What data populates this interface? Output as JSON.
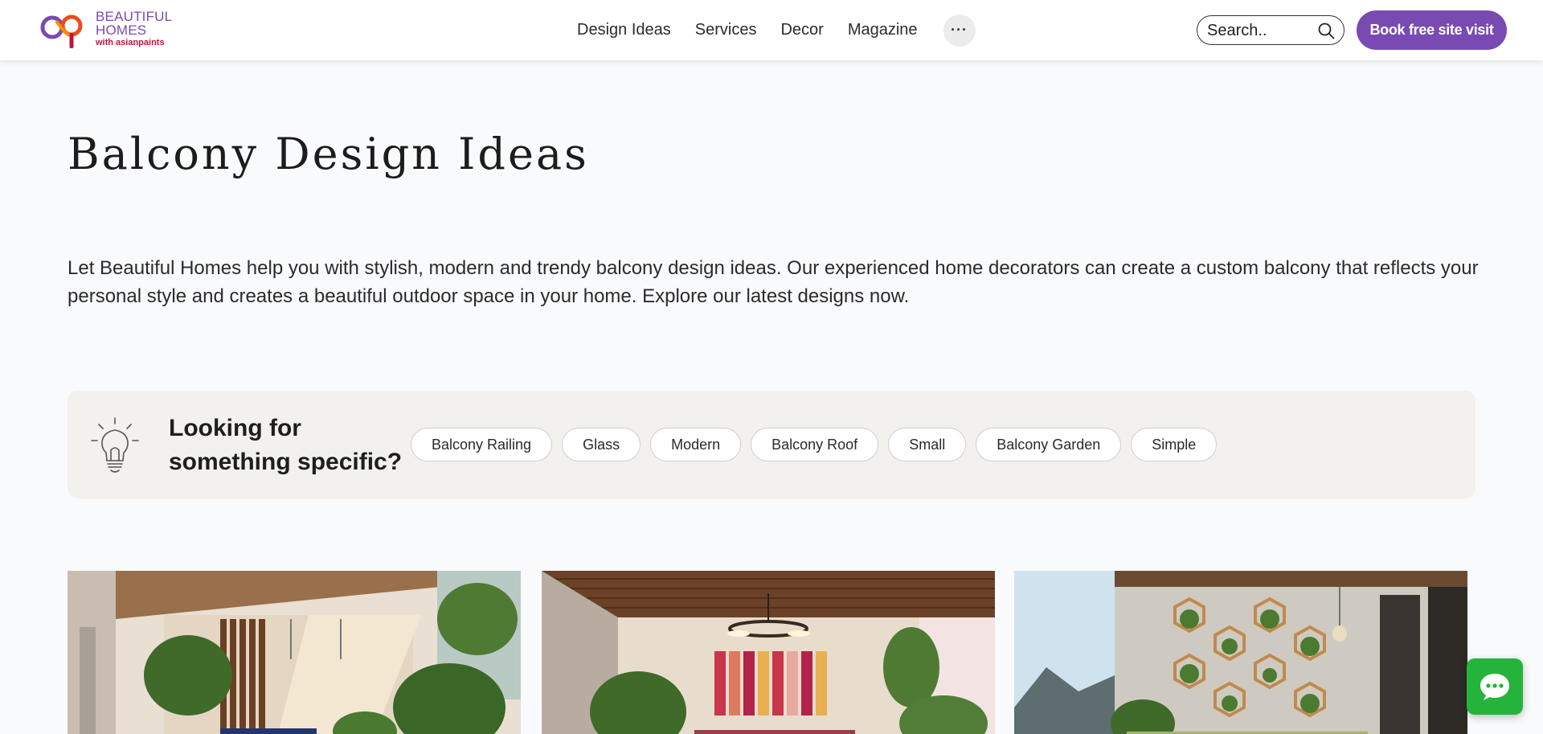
{
  "header": {
    "logo": {
      "line1": "BEAUTIFUL",
      "line2": "HOMES",
      "line3": "with asianpaints",
      "icon": "beautiful-homes-logo-icon"
    },
    "nav": {
      "items": [
        {
          "label": "Design Ideas"
        },
        {
          "label": "Services"
        },
        {
          "label": "Decor"
        },
        {
          "label": "Magazine"
        }
      ],
      "more_label": "···",
      "more_icon": "more-horizontal-icon"
    },
    "search": {
      "placeholder": "Search..",
      "value": "",
      "icon": "search-icon"
    },
    "cta_label": "Book free site visit"
  },
  "main": {
    "title": "Balcony Design Ideas",
    "intro": "Let Beautiful Homes help you with stylish, modern and trendy balcony design ideas. Our experienced home decorators can create a custom balcony that reflects your personal style and creates a beautiful outdoor space in your home. Explore our latest designs now.",
    "filter": {
      "icon": "lightbulb-icon",
      "heading": "Looking for something specific?",
      "chips": [
        {
          "label": "Balcony Railing"
        },
        {
          "label": "Glass"
        },
        {
          "label": "Modern"
        },
        {
          "label": "Balcony Roof"
        },
        {
          "label": "Small"
        },
        {
          "label": "Balcony Garden"
        },
        {
          "label": "Simple"
        }
      ]
    },
    "gallery": {
      "cards": [
        {
          "image": "balcony-wood-slat-ceiling-swing-image"
        },
        {
          "image": "balcony-ring-chandelier-textile-wall-image"
        },
        {
          "image": "balcony-hexagon-planter-wall-image"
        }
      ]
    }
  },
  "chat": {
    "icon": "chat-bubble-icon"
  },
  "colors": {
    "brand_purple": "#7a4ab3",
    "brand_red": "#c4133c",
    "chat_green": "#25b33c",
    "filter_bg": "#f2f1ee",
    "page_bg": "#f9fafc"
  }
}
